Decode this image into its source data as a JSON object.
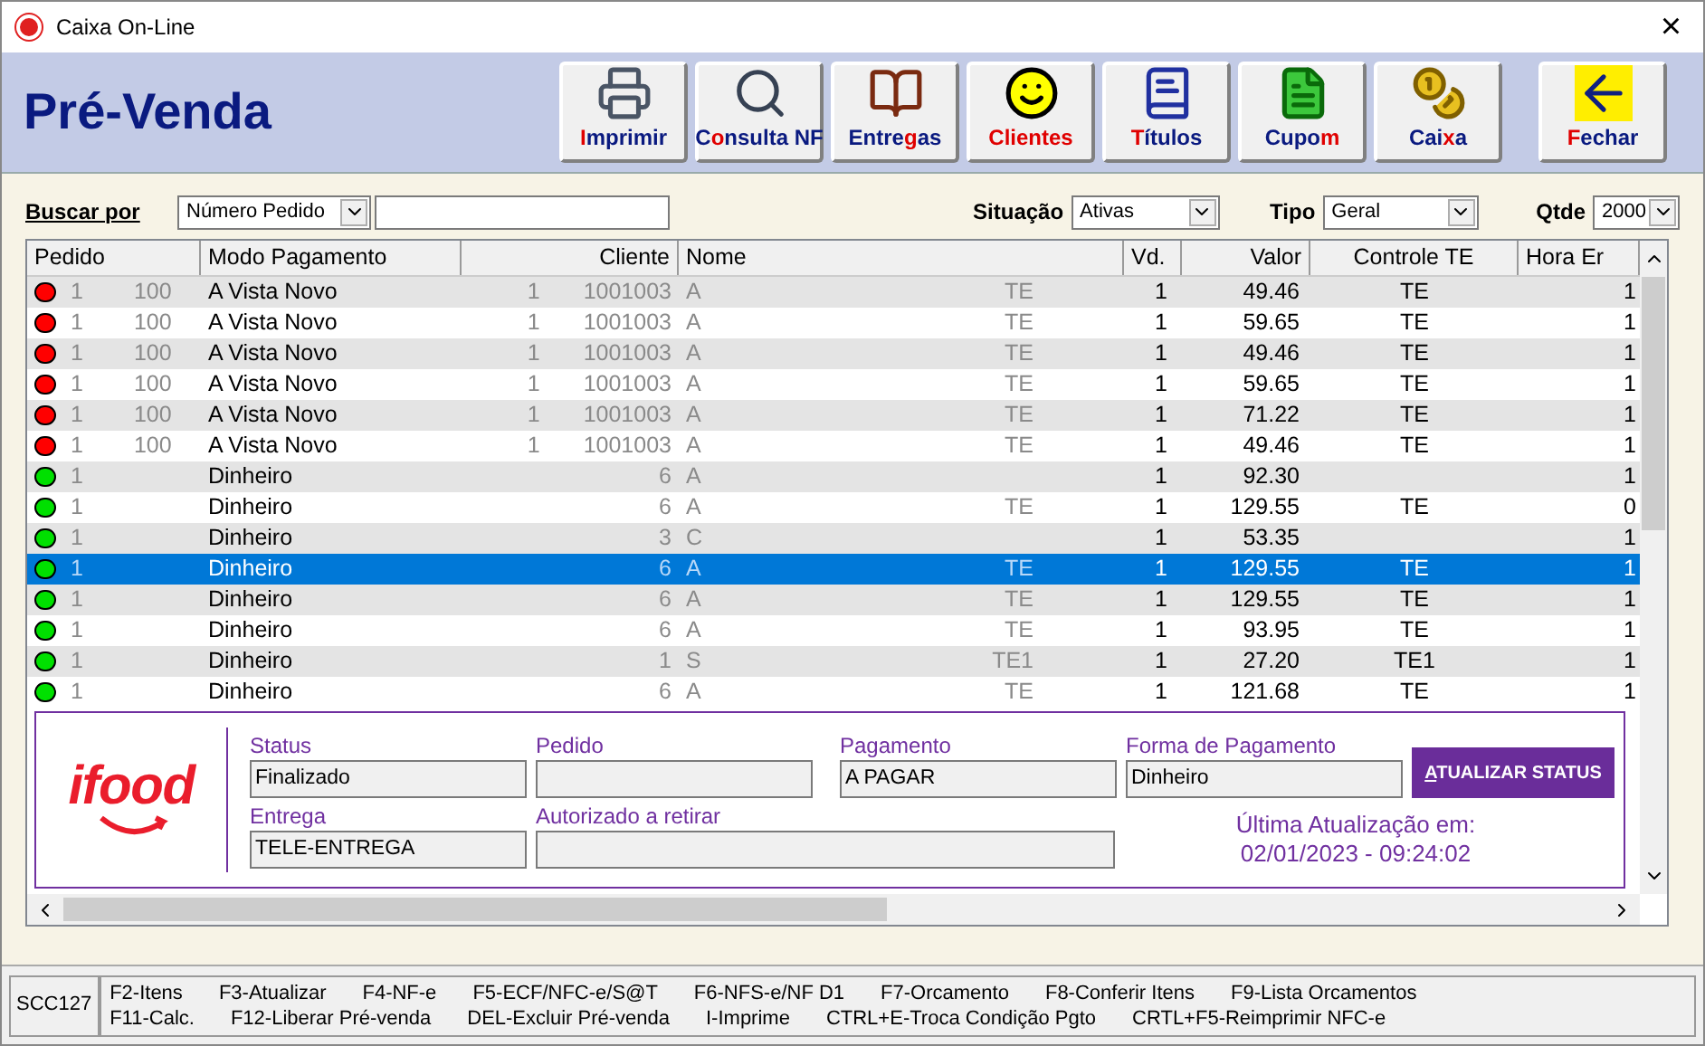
{
  "window": {
    "title": "Caixa On-Line",
    "close": "×"
  },
  "header": {
    "title": "Pré-Venda"
  },
  "toolbar": [
    {
      "kind": "printer",
      "key": "I",
      "after": "mprimir"
    },
    {
      "kind": "search",
      "before": "C",
      "key": "o",
      "after": "nsulta NF"
    },
    {
      "kind": "book",
      "before": "Entre",
      "key": "g",
      "after": "as"
    },
    {
      "kind": "smile",
      "key": "Clientes"
    },
    {
      "kind": "titles",
      "key": "T",
      "after": "ítulos"
    },
    {
      "kind": "coupon",
      "before": "Cupo",
      "key": "m"
    },
    {
      "kind": "coins",
      "before": "Cai",
      "key": "x",
      "after": "a"
    },
    {
      "kind": "close",
      "key": "F",
      "after": "echar"
    }
  ],
  "filters": {
    "search_by_label": "Buscar por",
    "search_by": "Número Pedido",
    "situation_label": "Situação",
    "situation": "Ativas",
    "type_label": "Tipo",
    "type": "Geral",
    "qty_label": "Qtde",
    "qty": "2000"
  },
  "table": {
    "columns": [
      "Pedido",
      "Modo Pagamento",
      "Cliente",
      "Nome",
      "Vd.",
      "Valor",
      "Controle TE",
      "Hora Er"
    ],
    "rows": [
      {
        "color": "#ff0000",
        "selected": false,
        "pedido": [
          "1",
          "100"
        ],
        "modo": "A Vista Novo",
        "cliente": [
          "1",
          "1001003"
        ],
        "nome": [
          "A",
          "TE"
        ],
        "vd": "1",
        "valor": "49.46",
        "controle": "TE",
        "hora": "1"
      },
      {
        "color": "#ff0000",
        "selected": false,
        "pedido": [
          "1",
          "100"
        ],
        "modo": "A Vista Novo",
        "cliente": [
          "1",
          "1001003"
        ],
        "nome": [
          "A",
          "TE"
        ],
        "vd": "1",
        "valor": "59.65",
        "controle": "TE",
        "hora": "1"
      },
      {
        "color": "#ff0000",
        "selected": false,
        "pedido": [
          "1",
          "100"
        ],
        "modo": "A Vista Novo",
        "cliente": [
          "1",
          "1001003"
        ],
        "nome": [
          "A",
          "TE"
        ],
        "vd": "1",
        "valor": "49.46",
        "controle": "TE",
        "hora": "1"
      },
      {
        "color": "#ff0000",
        "selected": false,
        "pedido": [
          "1",
          "100"
        ],
        "modo": "A Vista Novo",
        "cliente": [
          "1",
          "1001003"
        ],
        "nome": [
          "A",
          "TE"
        ],
        "vd": "1",
        "valor": "59.65",
        "controle": "TE",
        "hora": "1"
      },
      {
        "color": "#ff0000",
        "selected": false,
        "pedido": [
          "1",
          "100"
        ],
        "modo": "A Vista Novo",
        "cliente": [
          "1",
          "1001003"
        ],
        "nome": [
          "A",
          "TE"
        ],
        "vd": "1",
        "valor": "71.22",
        "controle": "TE",
        "hora": "1"
      },
      {
        "color": "#ff0000",
        "selected": false,
        "pedido": [
          "1",
          "100"
        ],
        "modo": "A Vista Novo",
        "cliente": [
          "1",
          "1001003"
        ],
        "nome": [
          "A",
          "TE"
        ],
        "vd": "1",
        "valor": "49.46",
        "controle": "TE",
        "hora": "1"
      },
      {
        "color": "#00e000",
        "selected": false,
        "pedido": [
          "1"
        ],
        "modo": "Dinheiro",
        "cliente": [
          "6"
        ],
        "nome": [
          "A"
        ],
        "vd": "1",
        "valor": "92.30",
        "hora": "1"
      },
      {
        "color": "#00e000",
        "selected": false,
        "pedido": [
          "1"
        ],
        "modo": "Dinheiro",
        "cliente": [
          "6"
        ],
        "nome": [
          "A",
          "TE"
        ],
        "vd": "1",
        "valor": "129.55",
        "controle": "TE",
        "hora": "0"
      },
      {
        "color": "#00e000",
        "selected": false,
        "pedido": [
          "1"
        ],
        "modo": "Dinheiro",
        "cliente": [
          "3"
        ],
        "nome": [
          "C"
        ],
        "vd": "1",
        "valor": "53.35",
        "hora": "1"
      },
      {
        "color": "#00e000",
        "selected": true,
        "pedido": [
          "1"
        ],
        "modo": "Dinheiro",
        "cliente": [
          "6"
        ],
        "nome": [
          "A",
          "TE"
        ],
        "vd": "1",
        "valor": "129.55",
        "controle": "TE",
        "hora": "1"
      },
      {
        "color": "#00e000",
        "selected": false,
        "pedido": [
          "1"
        ],
        "modo": "Dinheiro",
        "cliente": [
          "6"
        ],
        "nome": [
          "A",
          "TE"
        ],
        "vd": "1",
        "valor": "129.55",
        "controle": "TE",
        "hora": "1"
      },
      {
        "color": "#00e000",
        "selected": false,
        "pedido": [
          "1"
        ],
        "modo": "Dinheiro",
        "cliente": [
          "6"
        ],
        "nome": [
          "A",
          "TE"
        ],
        "vd": "1",
        "valor": "93.95",
        "controle": "TE",
        "hora": "1"
      },
      {
        "color": "#00e000",
        "selected": false,
        "pedido": [
          "1"
        ],
        "modo": "Dinheiro",
        "cliente": [
          "1"
        ],
        "nome": [
          "S",
          "TE1"
        ],
        "vd": "1",
        "valor": "27.20",
        "controle": "TE1",
        "hora": "1"
      },
      {
        "color": "#00e000",
        "selected": false,
        "pedido": [
          "1"
        ],
        "modo": "Dinheiro",
        "cliente": [
          "6"
        ],
        "nome": [
          "A",
          "TE"
        ],
        "vd": "1",
        "valor": "121.68",
        "controle": "TE",
        "hora": "1"
      }
    ]
  },
  "ifood_panel": {
    "logo": "ifood",
    "fields": [
      {
        "label": "Status",
        "value": "Finalizado"
      },
      {
        "label": "Pedido"
      },
      {
        "label": "Pagamento",
        "value": "A PAGAR"
      },
      {
        "label": "Forma de Pagamento",
        "value": "Dinheiro"
      },
      {
        "label": "Entrega",
        "value": "TELE-ENTREGA"
      },
      {
        "label": "Autorizado a retirar"
      }
    ],
    "button_key": "A",
    "button_rest": "TUALIZAR STATUS",
    "updated_label": "Última Atualização em:",
    "updated_value": "02/01/2023 - 09:24:02"
  },
  "status_bar": {
    "code": "SCC127",
    "shortcuts": [
      [
        "F2-Itens",
        "F3-Atualizar",
        "F4-NF-e",
        "F5-ECF/NFC-e/S@T",
        "F6-NFS-e/NF D1",
        "F7-Orcamento",
        "F8-Conferir Itens",
        "F9-Lista Orcamentos"
      ],
      [
        "F11-Calc.",
        "F12-Liberar Pré-venda",
        "DEL-Excluir Pré-venda",
        "I-Imprime",
        "CTRL+E-Troca Condição Pgto",
        "CRTL+F5-Reimprimir NFC-e"
      ]
    ]
  }
}
